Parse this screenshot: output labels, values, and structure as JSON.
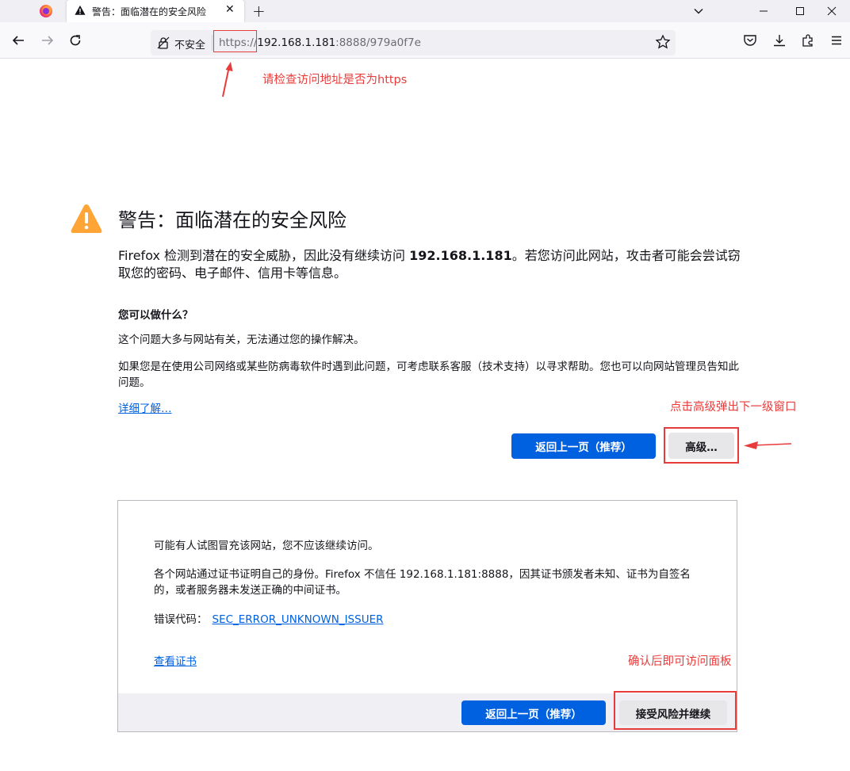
{
  "browser": {
    "tab_title": "警告：面临潜在的安全风险",
    "tab_close_glyph": "✕",
    "new_tab_glyph": "+",
    "insecure_label": "不安全",
    "url_scheme": "https://",
    "url_host": "192.168.1.181",
    "url_rest": ":8888/979a0f7e"
  },
  "annotations": {
    "check_https": "请检查访问地址是否为https",
    "click_advanced": "点击高级弹出下一级窗口",
    "confirm_access": "确认后即可访问面板"
  },
  "page": {
    "title": "警告：面临潜在的安全风险",
    "intro_before": "Firefox 检测到潜在的安全威胁，因此没有继续访问 ",
    "intro_host": "192.168.1.181",
    "intro_after": "。若您访问此网站，攻击者可能会尝试窃取您的密码、电子邮件、信用卡等信息。",
    "what_can_do": "您可以做什么？",
    "para1": "这个问题大多与网站有关，无法通过您的操作解决。",
    "para2": "如果您是在使用公司网络或某些防病毒软件时遇到此问题，可考虑联系客服（技术支持）以寻求帮助。您也可以向网站管理员告知此问题。",
    "learn_more": "详细了解…",
    "go_back": "返回上一页（推荐）",
    "advanced": "高级…"
  },
  "advanced_panel": {
    "line1": "可能有人试图冒充该网站，您不应该继续访问。",
    "line2": "各个网站通过证书证明自己的身份。Firefox 不信任 192.168.1.181:8888，因其证书颁发者未知、证书为自签名的，或者服务器未发送正确的中间证书。",
    "error_label": "错误代码：",
    "error_code": "SEC_ERROR_UNKNOWN_ISSUER",
    "view_cert": "查看证书",
    "go_back": "返回上一页（推荐）",
    "accept": "接受风险并继续"
  },
  "colors": {
    "accent": "#0061e0",
    "warning": "#ffa436",
    "annotation": "#e83b3b"
  }
}
